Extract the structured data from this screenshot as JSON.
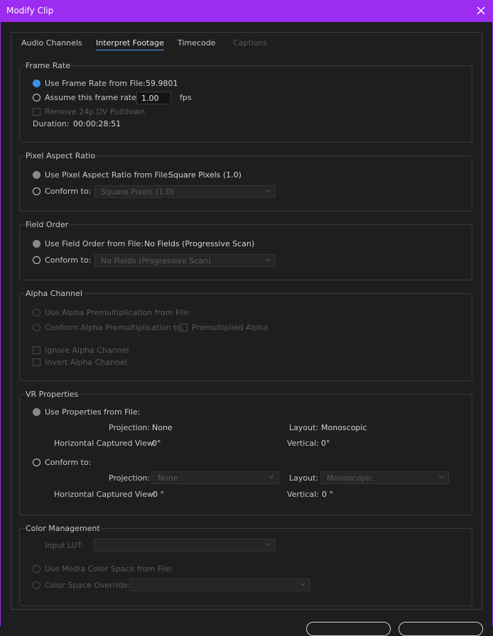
{
  "window": {
    "title": "Modify Clip"
  },
  "tabs": [
    {
      "label": "Audio Channels"
    },
    {
      "label": "Interpret Footage"
    },
    {
      "label": "Timecode"
    },
    {
      "label": "Captions"
    }
  ],
  "frame_rate": {
    "heading": "Frame Rate",
    "use_from_file_label": "Use Frame Rate from File:",
    "file_rate": "59.9801",
    "assume_label": "Assume this frame rate:",
    "assume_value": "1.00",
    "fps_unit": "fps",
    "remove_pulldown_label": "Remove 24p DV Pulldown",
    "duration_label": "Duration:",
    "duration_value": "00:00:28:51"
  },
  "pixel_aspect": {
    "heading": "Pixel Aspect Ratio",
    "use_from_file_label": "Use Pixel Aspect Ratio from File:",
    "file_value": "Square Pixels (1.0)",
    "conform_label": "Conform to:",
    "conform_value": "Square Pixels (1.0)"
  },
  "field_order": {
    "heading": "Field Order",
    "use_from_file_label": "Use Field Order from File:",
    "file_value": "No Fields (Progressive Scan)",
    "conform_label": "Conform to:",
    "conform_value": "No Fields (Progressive Scan)"
  },
  "alpha": {
    "heading": "Alpha Channel",
    "use_premult_label": "Use Alpha Premultiplication from File:",
    "conform_premult_label": "Conform Alpha Premultiplication to:",
    "premultiplied_label": "Premultiplied Alpha",
    "ignore_label": "Ignore Alpha Channel",
    "invert_label": "Invert Alpha Channel"
  },
  "vr": {
    "heading": "VR Properties",
    "use_from_file_label": "Use Properties from File:",
    "projection_label": "Projection:",
    "projection_value": "None",
    "layout_label": "Layout:",
    "layout_value": "Monoscopic",
    "hview_label": "Horizontal Captured View:",
    "hview_value": "0°",
    "vertical_label": "Vertical:",
    "vertical_value": "0°",
    "conform_label": "Conform to:",
    "conform_projection_label": "Projection:",
    "conform_projection_value": "None",
    "conform_layout_label": "Layout:",
    "conform_layout_value": "Monoscopic",
    "conform_hview_label": "Horizontal Captured View:",
    "conform_hview_value": "0 °",
    "conform_vertical_label": "Vertical:",
    "conform_vertical_value": "0 °"
  },
  "color": {
    "heading": "Color Management",
    "input_lut_label": "Input LUT:",
    "use_media_label": "Use Media Color Space from File:",
    "override_label": "Color Space Override:"
  },
  "colors": {
    "accent": "#9b2cf0",
    "radio_selected": "#3d8ee6"
  }
}
